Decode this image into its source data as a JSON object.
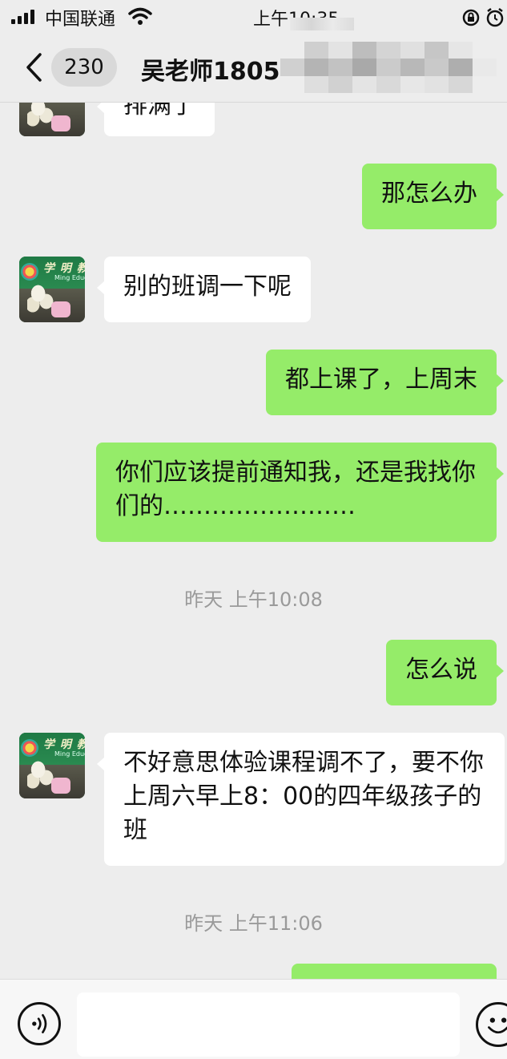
{
  "status_bar": {
    "carrier": "中国联通",
    "time": "上午10:35",
    "icons": [
      "signal-icon",
      "wifi-icon",
      "orientation-lock-icon",
      "alarm-icon"
    ]
  },
  "header": {
    "back_icon": "chevron-left-icon",
    "unread_count": "230",
    "title": "吴老师18056"
  },
  "colors": {
    "background": "#ededed",
    "incoming_bubble": "#ffffff",
    "outgoing_bubble": "#95ec69",
    "timestamp": "#9a9a9a"
  },
  "avatar": {
    "sign_text": "学 明 教 育",
    "sign_sub": "Ming Education"
  },
  "messages": [
    {
      "side": "in",
      "text": "排满了"
    },
    {
      "side": "out",
      "text": "那怎么办"
    },
    {
      "side": "in",
      "text": "别的班调一下呢"
    },
    {
      "side": "out",
      "text": "都上课了，上周末"
    },
    {
      "side": "out",
      "text": "你们应该提前通知我，还是我找你们的……………………"
    },
    {
      "side": "time",
      "text": "昨天 上午10:08"
    },
    {
      "side": "out",
      "text": "怎么说"
    },
    {
      "side": "in",
      "text": "不好意思体验课程调不了，要不你上周六早上8：00的四年级孩子的班"
    },
    {
      "side": "time",
      "text": "昨天 上午11:06"
    },
    {
      "side": "out",
      "text": ""
    }
  ],
  "input_bar": {
    "voice_icon": "voice-input-icon",
    "input_value": "",
    "emoji_icon": "emoji-icon"
  }
}
